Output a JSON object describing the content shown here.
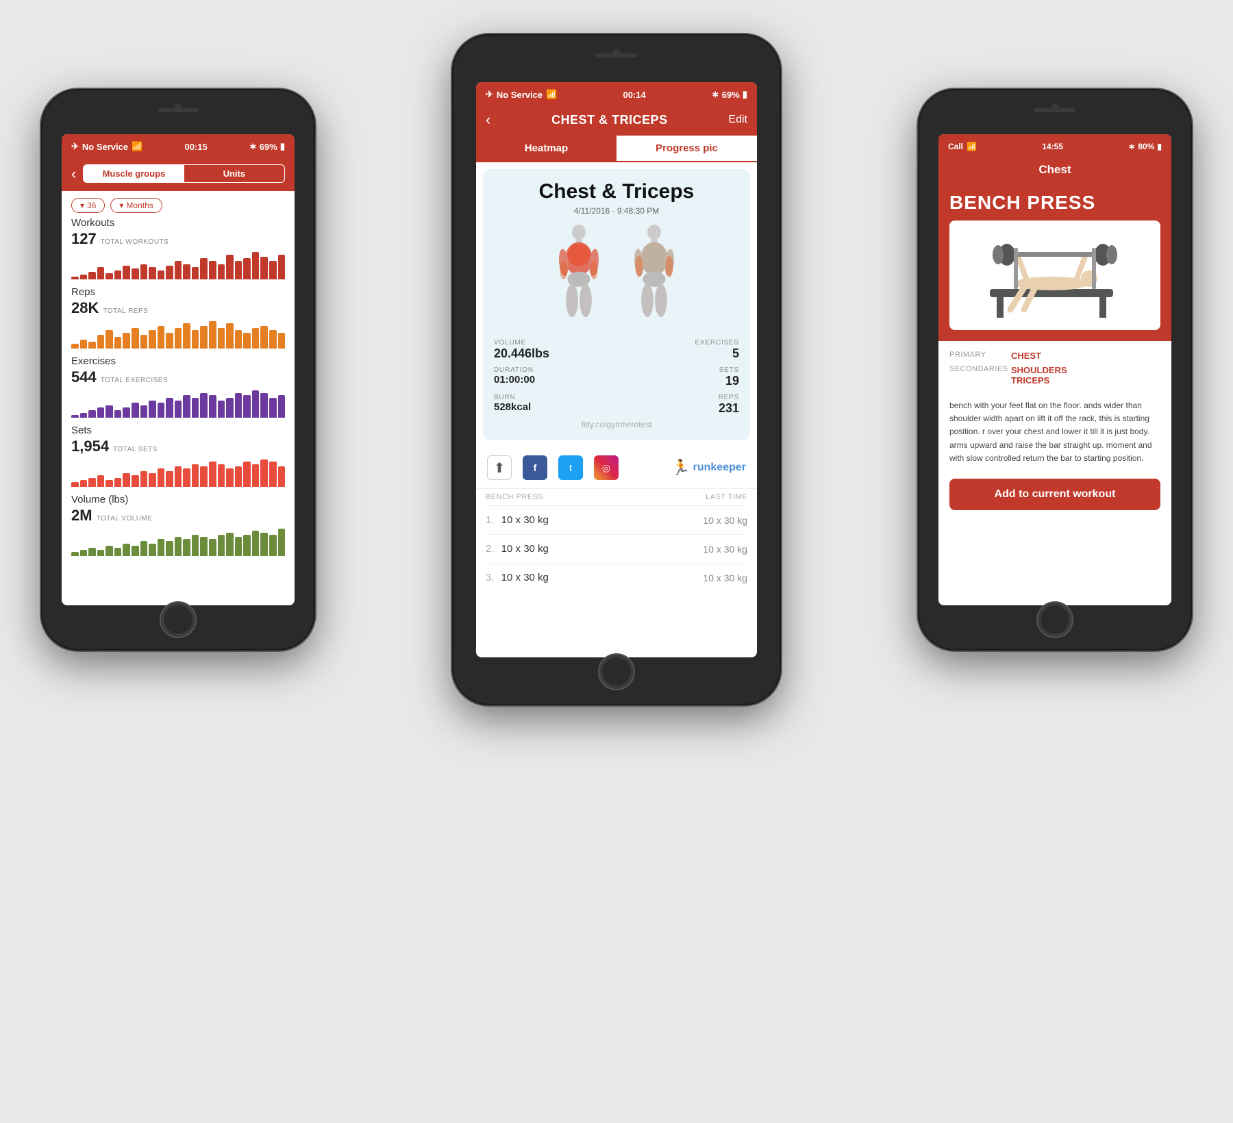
{
  "background_color": "#e0e0e0",
  "accent_color": "#c0392b",
  "phone_left": {
    "status": {
      "carrier": "No Service",
      "time": "00:15",
      "battery": "69%"
    },
    "nav": {
      "back": "‹",
      "tab1": "Muscle groups",
      "tab2": "Units"
    },
    "filters": {
      "count": "36",
      "period": "Months"
    },
    "sections": [
      {
        "label": "Workouts",
        "value": "127",
        "sub": "TOTAL WORKOUTS",
        "color": "#c0392b",
        "bars": [
          2,
          3,
          5,
          8,
          4,
          6,
          9,
          7,
          10,
          8,
          6,
          9,
          12,
          10,
          8,
          14,
          12,
          10,
          16,
          12,
          14,
          18,
          15,
          12,
          16
        ]
      },
      {
        "label": "Reps",
        "value": "28K",
        "sub": "TOTAL REPS",
        "color": "#e67e22",
        "bars": [
          2,
          4,
          3,
          6,
          8,
          5,
          7,
          9,
          6,
          8,
          10,
          7,
          9,
          11,
          8,
          10,
          12,
          9,
          11,
          8,
          7,
          9,
          10,
          8,
          7
        ]
      },
      {
        "label": "Exercises",
        "value": "544",
        "sub": "TOTAL EXERCISES",
        "color": "#6c3a9e",
        "bars": [
          1,
          2,
          3,
          4,
          5,
          3,
          4,
          6,
          5,
          7,
          6,
          8,
          7,
          9,
          8,
          10,
          9,
          7,
          8,
          10,
          9,
          11,
          10,
          8,
          9
        ]
      },
      {
        "label": "Sets",
        "value": "1,954",
        "sub": "TOTAL SETS",
        "color": "#e74c3c",
        "bars": [
          2,
          3,
          4,
          5,
          3,
          4,
          6,
          5,
          7,
          6,
          8,
          7,
          9,
          8,
          10,
          9,
          11,
          10,
          8,
          9,
          11,
          10,
          12,
          11,
          9
        ]
      },
      {
        "label": "Volume (lbs)",
        "value": "2M",
        "sub": "TOTAL VOLUME",
        "color": "#6b8c3a",
        "bars": [
          2,
          3,
          4,
          3,
          5,
          4,
          6,
          5,
          7,
          6,
          8,
          7,
          9,
          8,
          10,
          9,
          8,
          10,
          11,
          9,
          10,
          12,
          11,
          10,
          13
        ]
      }
    ]
  },
  "phone_center": {
    "status": {
      "carrier": "No Service",
      "time": "00:14",
      "battery": "69%"
    },
    "header": {
      "title": "CHEST & TRICEPS",
      "edit": "Edit"
    },
    "tabs": [
      "Heatmap",
      "Progress pic"
    ],
    "active_tab": 0,
    "workout": {
      "title": "Chest & Triceps",
      "date": "4/11/2016 · 9:48:30 PM",
      "volume": "20.446lbs",
      "exercises": "5",
      "duration": "01:00:00",
      "sets": "19",
      "burn": "528kcal",
      "reps": "231",
      "watermark": "fitty.co/gymherotest"
    },
    "share": {
      "facebook": "f",
      "twitter": "t",
      "instagram": "◎",
      "runkeeper": "runkeeper"
    },
    "exercise_table": {
      "col1": "BENCH PRESS",
      "col2": "LAST TIME",
      "rows": [
        {
          "num": "1.",
          "val": "10 x 30 kg",
          "last": "10 x 30 kg"
        },
        {
          "num": "2.",
          "val": "10 x 30 kg",
          "last": "10 x 30 kg"
        },
        {
          "num": "3.",
          "val": "10 x 30 kg",
          "last": "10 x 30 kg"
        }
      ]
    }
  },
  "phone_right": {
    "status": {
      "carrier": "Call",
      "time": "14:55",
      "battery": "80%"
    },
    "header": {
      "title": "Chest"
    },
    "exercise": {
      "title": "BENCH PRESS",
      "primary": "CHEST",
      "secondaries": [
        "SHOULDERS",
        "TRICEPS"
      ],
      "description": "bench with your feet flat on the floor. ands wider than shoulder width apart on lift it off the rack, this is starting position. r over your chest and lower it till it is just body.\n\narms upward and raise the bar straight up. moment and with slow controlled return the bar to starting position."
    },
    "cta": "Add to current workout"
  }
}
